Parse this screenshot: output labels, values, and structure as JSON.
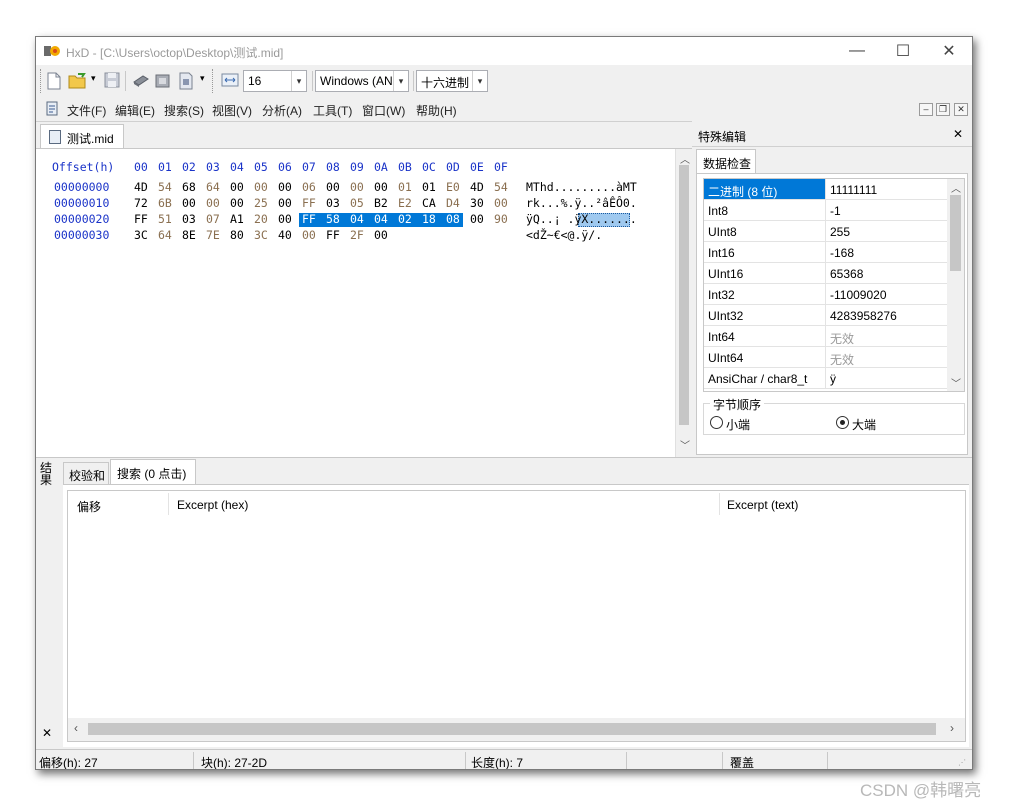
{
  "window": {
    "title": "HxD - [C:\\Users\\octop\\Desktop\\测试.mid]",
    "minimize_glyph": "—",
    "maximize_glyph": "☐",
    "close_glyph": "✕"
  },
  "toolbar": {
    "icons": [
      "new-file-icon",
      "open-folder-icon",
      "save-icon",
      "open-disk-icon",
      "open-ram-icon",
      "document-icon",
      "columns-icon"
    ],
    "bytes_per_row": "16",
    "charset": "Windows (ANSI)",
    "offset_base": "十六进制",
    "dropdown_glyph": "▾"
  },
  "menu": {
    "items": [
      "文件(F)",
      "编辑(E)",
      "搜索(S)",
      "视图(V)",
      "分析(A)",
      "工具(T)",
      "窗口(W)",
      "帮助(H)"
    ],
    "mdi_minimize": "–",
    "mdi_restore": "❐",
    "mdi_close": "✕"
  },
  "document": {
    "tab_label": "测试.mid",
    "header_label": "Offset(h)",
    "header_columns": [
      "00",
      "01",
      "02",
      "03",
      "04",
      "05",
      "06",
      "07",
      "08",
      "09",
      "0A",
      "0B",
      "0C",
      "0D",
      "0E",
      "0F"
    ],
    "rows": [
      {
        "offset": "00000000",
        "bytes": [
          "4D",
          "54",
          "68",
          "64",
          "00",
          "00",
          "00",
          "06",
          "00",
          "00",
          "00",
          "01",
          "01",
          "E0",
          "4D",
          "54"
        ],
        "text": "MThd.........àMT"
      },
      {
        "offset": "00000010",
        "bytes": [
          "72",
          "6B",
          "00",
          "00",
          "00",
          "25",
          "00",
          "FF",
          "03",
          "05",
          "B2",
          "E2",
          "CA",
          "D4",
          "30",
          "00"
        ],
        "text": "rk...%.ÿ..²âÊÔ0."
      },
      {
        "offset": "00000020",
        "bytes": [
          "FF",
          "51",
          "03",
          "07",
          "A1",
          "20",
          "00",
          "FF",
          "58",
          "04",
          "04",
          "02",
          "18",
          "08",
          "00",
          "90"
        ],
        "text": "ÿQ..¡ .ÿX.......",
        "selection_start": 7,
        "selection_end": 13
      },
      {
        "offset": "00000030",
        "bytes": [
          "3C",
          "64",
          "8E",
          "7E",
          "80",
          "3C",
          "40",
          "00",
          "FF",
          "2F",
          "00"
        ],
        "text": "<dŽ~€<@.ÿ/."
      }
    ],
    "colors": {
      "offset": "#1a33c8",
      "dark_byte": "#000000",
      "light_byte": "#8a6f50",
      "selection": "#0078d7",
      "text_selection": "#9fc9ef"
    }
  },
  "inspector": {
    "panel_title": "特殊编辑",
    "close_glyph": "✕",
    "tab_label": "数据检查",
    "rows": [
      {
        "key": "二进制 (8 位)",
        "value": "11111111",
        "selected": true
      },
      {
        "key": "Int8",
        "value": "-1"
      },
      {
        "key": "UInt8",
        "value": "255"
      },
      {
        "key": "Int16",
        "value": "-168"
      },
      {
        "key": "UInt16",
        "value": "65368"
      },
      {
        "key": "Int32",
        "value": "-11009020"
      },
      {
        "key": "UInt32",
        "value": "4283958276"
      },
      {
        "key": "Int64",
        "value": "无效",
        "invalid": true
      },
      {
        "key": "UInt64",
        "value": "无效",
        "invalid": true
      },
      {
        "key": "AnsiChar / char8_t",
        "value": "ÿ"
      }
    ],
    "byte_order_label": "字节顺序",
    "little_endian": "小端",
    "big_endian": "大端",
    "selected_order": "big"
  },
  "results": {
    "side_label": "结果",
    "tabs": [
      {
        "label": "校验和"
      },
      {
        "label": "搜索 (0 点击)",
        "active": true
      }
    ],
    "columns": [
      "偏移",
      "Excerpt (hex)",
      "Excerpt (text)"
    ],
    "close_glyph": "✕"
  },
  "status": {
    "offset": "偏移(h): 27",
    "block": "块(h): 27-2D",
    "length": "长度(h): 7",
    "mode": "覆盖"
  },
  "watermark": "CSDN @韩曙亮"
}
